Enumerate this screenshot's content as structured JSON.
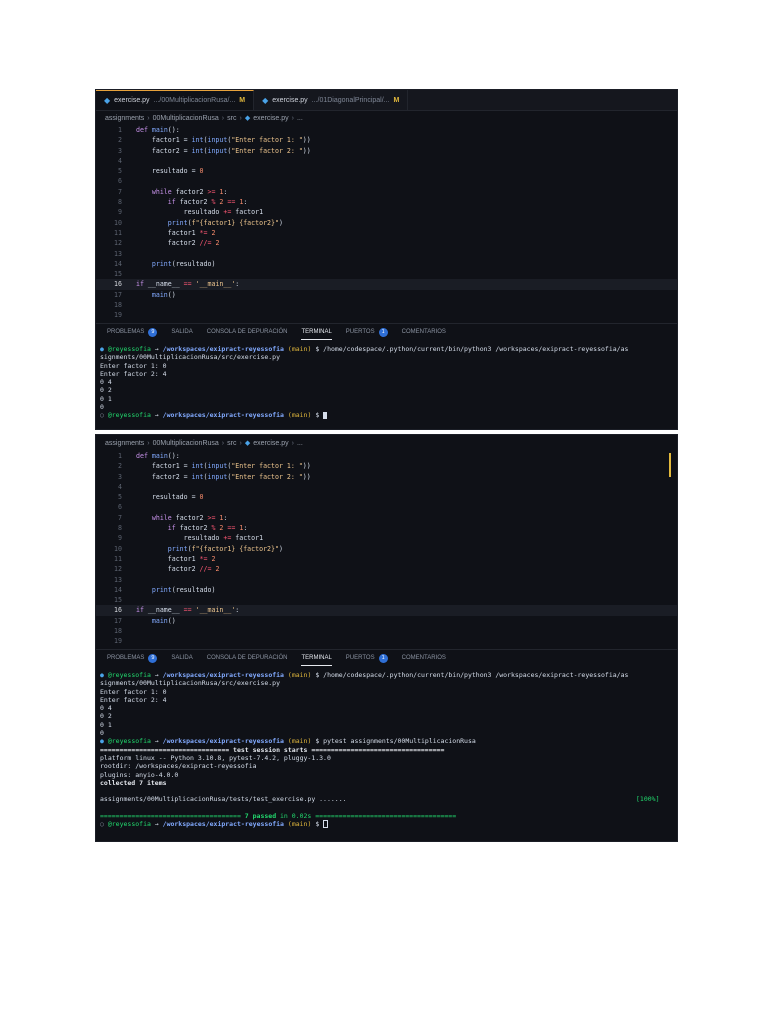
{
  "tabs": [
    {
      "file": "exercise.py",
      "path": ".../00MultiplicacionRusa/...",
      "modified": "M"
    },
    {
      "file": "exercise.py",
      "path": ".../01DiagonalPrincipal/...",
      "modified": "M"
    }
  ],
  "breadcrumb": {
    "items": [
      "assignments",
      "00MultiplicacionRusa",
      "src",
      "exercise.py",
      "..."
    ]
  },
  "code_lines": [
    {
      "n": "1",
      "html": "<span class='k'>def</span> <span class='f'>main</span>():"
    },
    {
      "n": "2",
      "html": "    factor1 = <span class='f'>int</span>(<span class='f'>input</span>(<span class='s'>\"Enter factor 1: \"</span>))"
    },
    {
      "n": "3",
      "html": "    factor2 = <span class='f'>int</span>(<span class='f'>input</span>(<span class='s'>\"Enter factor 2: \"</span>))"
    },
    {
      "n": "4",
      "html": ""
    },
    {
      "n": "5",
      "html": "    resultado = <span class='n'>0</span>"
    },
    {
      "n": "6",
      "html": ""
    },
    {
      "n": "7",
      "html": "    <span class='k'>while</span> factor2 <span class='o'>&gt;=</span> <span class='n'>1</span>:"
    },
    {
      "n": "8",
      "html": "        <span class='k'>if</span> factor2 <span class='o'>%</span> <span class='n'>2</span> <span class='o'>==</span> <span class='n'>1</span>:"
    },
    {
      "n": "9",
      "html": "            resultado <span class='o'>+=</span> factor1"
    },
    {
      "n": "10",
      "html": "        <span class='f'>print</span>(<span class='s'>f\"{factor1} {factor2}\"</span>)"
    },
    {
      "n": "11",
      "html": "        factor1 <span class='o'>*=</span> <span class='n'>2</span>"
    },
    {
      "n": "12",
      "html": "        factor2 <span class='o'>//=</span> <span class='n'>2</span>"
    },
    {
      "n": "13",
      "html": ""
    },
    {
      "n": "14",
      "html": "    <span class='f'>print</span>(resultado)"
    },
    {
      "n": "15",
      "html": ""
    },
    {
      "n": "16",
      "html": "<span class='k'>if</span> __name__ <span class='o'>==</span> <span class='s'>'__main__'</span>:",
      "current": true
    },
    {
      "n": "17",
      "html": "    <span class='f'>main</span>()"
    },
    {
      "n": "18",
      "html": ""
    },
    {
      "n": "19",
      "html": ""
    }
  ],
  "panel_tabs": [
    {
      "label": "PROBLEMAS",
      "badge": "9"
    },
    {
      "label": "SALIDA"
    },
    {
      "label": "CONSOLA DE DEPURACIÓN"
    },
    {
      "label": "TERMINAL",
      "active": true
    },
    {
      "label": "PUERTOS",
      "badge": "1"
    },
    {
      "label": "COMENTARIOS"
    }
  ],
  "terminal": {
    "user": "@reyessofia",
    "arrow": "→",
    "path": "/workspaces/exipract-reyessofia",
    "branch": "(main)",
    "dollar": "$",
    "run_cmd_1": "/home/codespace/.python/current/bin/python3 /workspaces/exipract-reyessofia/as",
    "run_cmd_2": "signments/00MultiplicacionRusa/src/exercise.py",
    "output": [
      "Enter factor 1: 0",
      "Enter factor 2: 4",
      "0 4",
      "0 2",
      "0 1",
      "0"
    ],
    "pytest_cmd": "pytest assignments/00MultiplicacionRusa",
    "session_line": "================================= test session starts ==================================",
    "platform": "platform linux -- Python 3.10.8, pytest-7.4.2, pluggy-1.3.0",
    "rootdir": "rootdir: /workspaces/exipract-reyessofia",
    "plugins": "plugins: anyio-4.0.0",
    "collected": "collected 7 items",
    "test_file": "assignments/00MultiplicacionRusa/tests/test_exercise.py .......",
    "percent": "[100%]",
    "passed_left": "==================================== ",
    "passed_text": "7 passed",
    "passed_time": " in 0.02s",
    "passed_right": " ===================================="
  }
}
